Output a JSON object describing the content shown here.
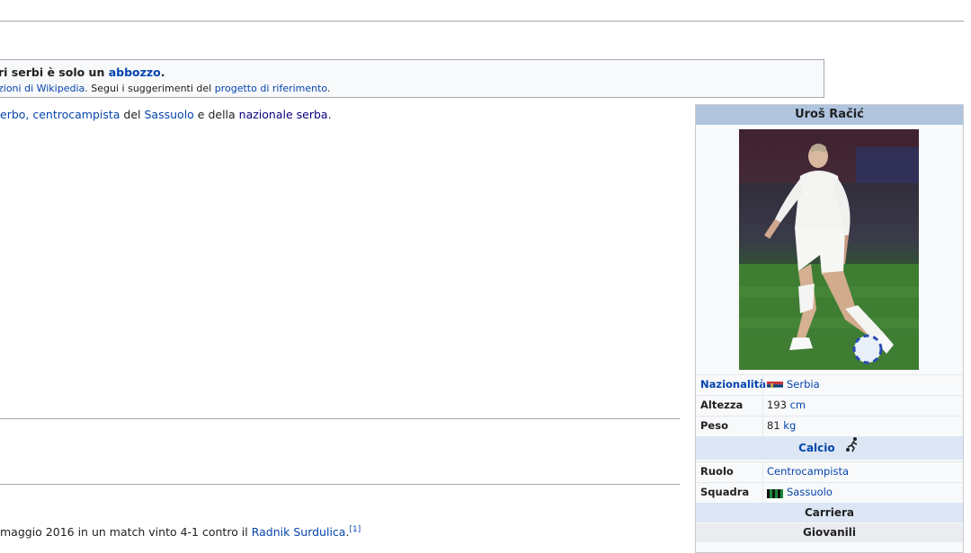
{
  "notice": {
    "line1_prefix": "ri serbi è solo un ",
    "line1_link": "abbozzo",
    "line1_suffix": ".",
    "line2_link1": "zioni di Wikipedia",
    "line2_mid": ". Segui i suggerimenti del ",
    "line2_link2": "progetto di riferimento",
    "line2_suffix": "."
  },
  "intro": {
    "link1": "erbo, centrocampista",
    "t1": " del ",
    "link2": "Sassuolo",
    "t2": " e della ",
    "link3": "nazionale serba",
    "t3": "."
  },
  "career_para": {
    "text": "maggio 2016 in un match vinto 4-1 contro il ",
    "link": "Radnik Surdulica",
    "suffix": ".",
    "ref": "[1]"
  },
  "infobox": {
    "title": "Uroš Račić",
    "nazionalita_key": "Nazionalità",
    "nazionalita_val": "Serbia",
    "altezza_key": "Altezza",
    "altezza_num": "193 ",
    "altezza_unit": "cm",
    "peso_key": "Peso",
    "peso_num": "81 ",
    "peso_unit": "kg",
    "sport_head": "Calcio",
    "ruolo_key": "Ruolo",
    "ruolo_val": "Centrocampista",
    "squadra_key": "Squadra",
    "squadra_val": "Sassuolo",
    "carriera": "Carriera",
    "giovanili": "Giovanili"
  },
  "colors": {
    "link": "#0645ad",
    "infobox_title_bg": "#b0c4de",
    "section_bg": "#dce6f4"
  }
}
